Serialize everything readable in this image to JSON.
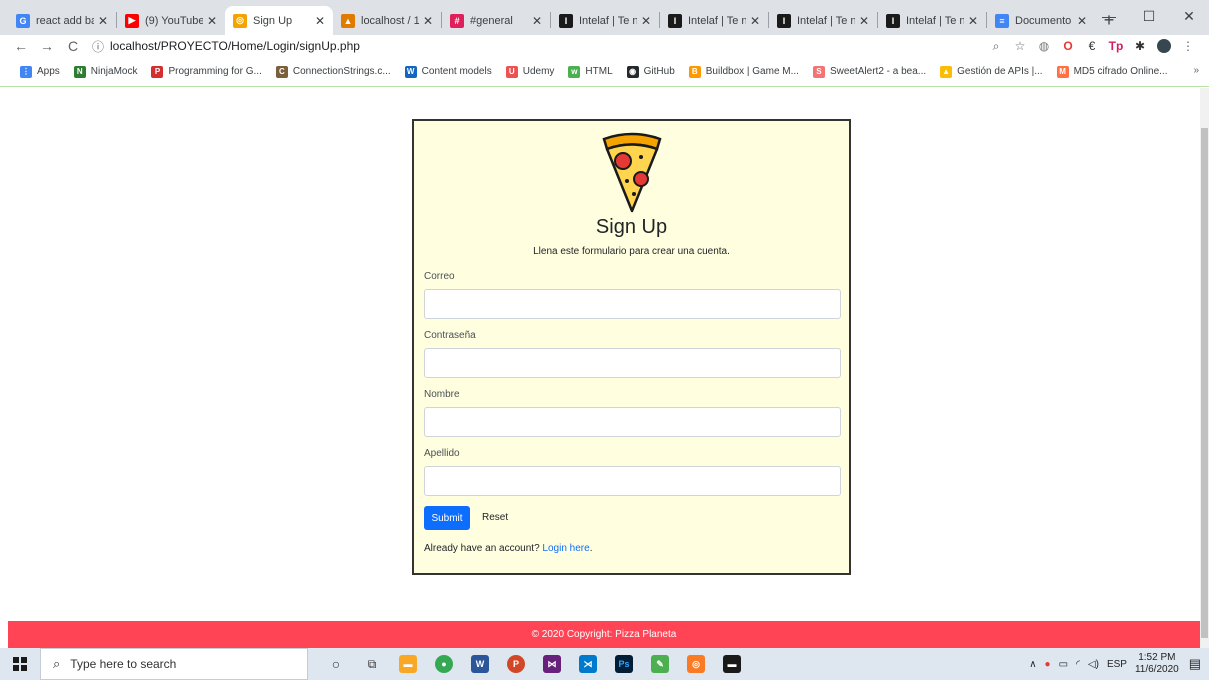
{
  "browser": {
    "tabs": [
      {
        "title": "react add ba",
        "icon": "google-icon",
        "color": "#4285f4",
        "glyph": "G"
      },
      {
        "title": "(9) YouTube",
        "icon": "youtube-icon",
        "color": "#ff0000",
        "glyph": "▶"
      },
      {
        "title": "Sign Up",
        "icon": "pizza-favicon-icon",
        "color": "#f4a300",
        "glyph": "◎",
        "active": true
      },
      {
        "title": "localhost / 1",
        "icon": "phpmyadmin-icon",
        "color": "#e07b00",
        "glyph": "▲"
      },
      {
        "title": "#general",
        "icon": "slack-icon",
        "color": "#e01e5a",
        "glyph": "#"
      },
      {
        "title": "Intelaf | Te n",
        "icon": "intelaf-icon",
        "color": "#1a1a1a",
        "glyph": "I"
      },
      {
        "title": "Intelaf | Te n",
        "icon": "intelaf-icon",
        "color": "#1a1a1a",
        "glyph": "I"
      },
      {
        "title": "Intelaf | Te n",
        "icon": "intelaf-icon",
        "color": "#1a1a1a",
        "glyph": "I"
      },
      {
        "title": "Intelaf | Te n",
        "icon": "intelaf-icon",
        "color": "#1a1a1a",
        "glyph": "I"
      },
      {
        "title": "Documento",
        "icon": "docs-icon",
        "color": "#4285f4",
        "glyph": "≡"
      }
    ],
    "url": "localhost/PROYECTO/Home/Login/signUp.php",
    "bookmarks": [
      {
        "label": "Apps",
        "icon": "apps-grid-icon",
        "color": "#4285f4",
        "glyph": "⋮"
      },
      {
        "label": "NinjaMock",
        "icon": "ninjamock-icon",
        "color": "#2e7d32",
        "glyph": "N"
      },
      {
        "label": "Programming for G...",
        "icon": "programming-icon",
        "color": "#d32f2f",
        "glyph": "P"
      },
      {
        "label": "ConnectionStrings.c...",
        "icon": "connectionstrings-icon",
        "color": "#7b5e3b",
        "glyph": "C"
      },
      {
        "label": "Content models",
        "icon": "w3-icon",
        "color": "#1565c0",
        "glyph": "W"
      },
      {
        "label": "Udemy",
        "icon": "udemy-icon",
        "color": "#ec5252",
        "glyph": "U"
      },
      {
        "label": "HTML",
        "icon": "w3schools-icon",
        "color": "#4caf50",
        "glyph": "w"
      },
      {
        "label": "GitHub",
        "icon": "github-icon",
        "color": "#24292e",
        "glyph": "◉"
      },
      {
        "label": "Buildbox | Game M...",
        "icon": "buildbox-icon",
        "color": "#ff9800",
        "glyph": "B"
      },
      {
        "label": "SweetAlert2 - a bea...",
        "icon": "sweetalert-icon",
        "color": "#f27474",
        "glyph": "S"
      },
      {
        "label": "Gestión de APIs |...",
        "icon": "google-cloud-icon",
        "color": "#fbbc05",
        "glyph": "▲"
      },
      {
        "label": "MD5 cifrado Online...",
        "icon": "md5-icon",
        "color": "#ff7043",
        "glyph": "M"
      }
    ],
    "bookmarks_more": "»"
  },
  "form": {
    "title": "Sign Up",
    "subtitle": "Llena este formulario para crear una cuenta.",
    "fields": [
      {
        "label": "Correo",
        "value": ""
      },
      {
        "label": "Contraseña",
        "value": ""
      },
      {
        "label": "Nombre",
        "value": ""
      },
      {
        "label": "Apellido",
        "value": ""
      }
    ],
    "submit_label": "Submit",
    "reset_label": "Reset",
    "login_prompt": "Already have an account?",
    "login_link": "Login here",
    "login_suffix": "."
  },
  "footer": {
    "text": "© 2020 Copyright: Pizza Planeta",
    "color": "#ff4455"
  },
  "taskbar": {
    "search_placeholder": "Type here to search",
    "language": "ESP",
    "time": "1:52 PM",
    "date": "11/6/2020"
  }
}
